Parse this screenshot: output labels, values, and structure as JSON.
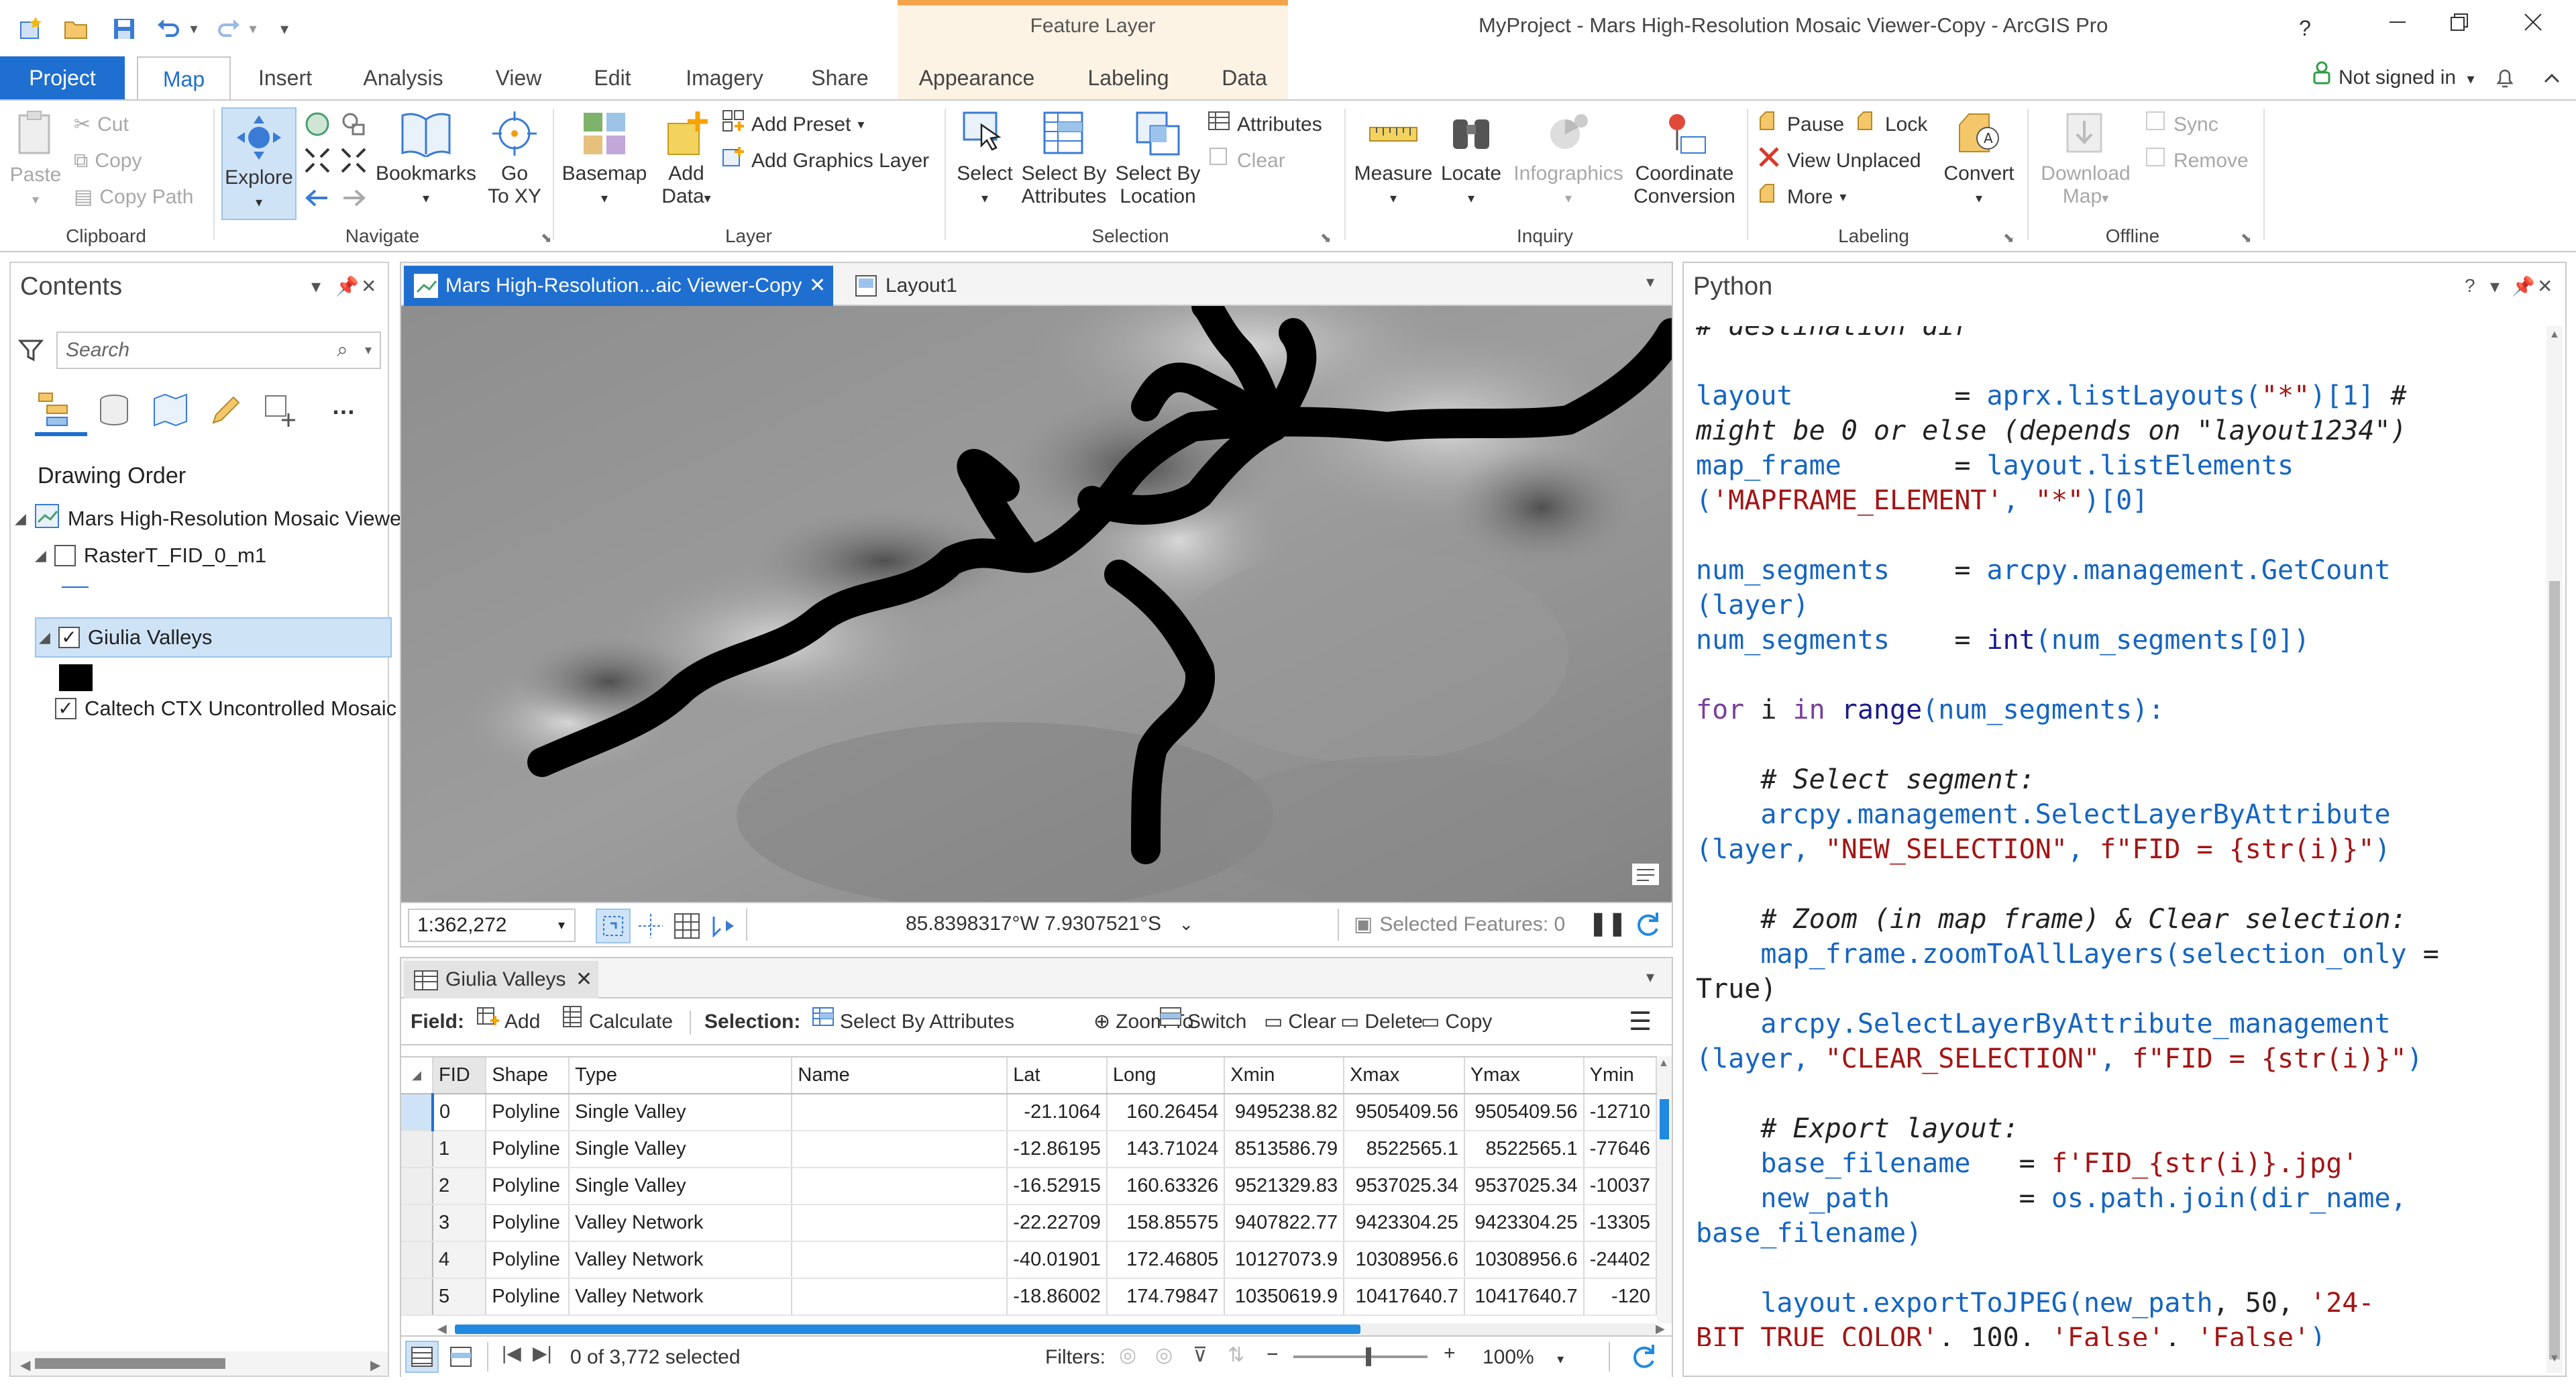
{
  "window": {
    "title": "MyProject - Mars High-Resolution Mosaic Viewer-Copy - ArcGIS Pro",
    "context_group": "Feature Layer",
    "help": "?",
    "signin": "Not signed in",
    "signin_arrow": "▾"
  },
  "ribbon_tabs": [
    "Project",
    "Map",
    "Insert",
    "Analysis",
    "View",
    "Edit",
    "Imagery",
    "Share",
    "Appearance",
    "Labeling",
    "Data"
  ],
  "ribbon": {
    "clipboard": {
      "label": "Clipboard",
      "paste": "Paste",
      "cut": "Cut",
      "copy": "Copy",
      "copy_path": "Copy Path"
    },
    "navigate": {
      "label": "Navigate",
      "explore": "Explore",
      "bookmarks": "Bookmarks",
      "goto": "Go",
      "goto2": "To XY"
    },
    "layer": {
      "label": "Layer",
      "basemap": "Basemap",
      "add_data": "Add",
      "add_data2": "Data",
      "add_preset": "Add Preset",
      "add_graphics": "Add Graphics Layer"
    },
    "selection": {
      "label": "Selection",
      "select": "Select",
      "by_attr": "Select By",
      "by_attr2": "Attributes",
      "by_loc": "Select By",
      "by_loc2": "Location",
      "attributes": "Attributes",
      "clear": "Clear"
    },
    "inquiry": {
      "label": "Inquiry",
      "measure": "Measure",
      "locate": "Locate",
      "infographics": "Infographics",
      "coord": "Coordinate",
      "coord2": "Conversion"
    },
    "labeling": {
      "label": "Labeling",
      "pause": "Pause",
      "lock": "Lock",
      "view_unplaced": "View Unplaced",
      "more": "More",
      "convert": "Convert"
    },
    "offline": {
      "label": "Offline",
      "download": "Download",
      "download2": "Map",
      "sync": "Sync",
      "remove": "Remove"
    }
  },
  "contents": {
    "title": "Contents",
    "search_placeholder": "Search",
    "drawing_order": "Drawing Order",
    "map_name": "Mars High-Resolution Mosaic Viewe",
    "layers": [
      {
        "name": "RasterT_FID_0_m1",
        "checked": false
      },
      {
        "name": "Giulia Valleys",
        "checked": true
      },
      {
        "name": "Caltech CTX Uncontrolled Mosaic",
        "checked": true
      }
    ]
  },
  "map": {
    "tab1": "Mars High-Resolution...aic Viewer-Copy",
    "tab2": "Layout1",
    "scale": "1:362,272",
    "coords": "85.8398317°W 7.9307521°S",
    "selected_features": "Selected Features: 0"
  },
  "attribute_table": {
    "tab": "Giulia Valleys",
    "field_label": "Field:",
    "add": "Add",
    "calculate": "Calculate",
    "selection_label": "Selection:",
    "select_by_attr": "Select By Attributes",
    "zoom_to": "Zoom To",
    "switch": "Switch",
    "clear": "Clear",
    "delete": "Delete",
    "copy": "Copy",
    "columns": [
      "FID",
      "Shape",
      "Type",
      "Name",
      "Lat",
      "Long",
      "Xmin",
      "Xmax",
      "Ymax",
      "Ymin"
    ],
    "rows": [
      [
        "0",
        "Polyline",
        "Single Valley",
        "",
        "-21.1064",
        "160.26454",
        "9495238.82",
        "9505409.56",
        "9505409.56",
        "-12710"
      ],
      [
        "1",
        "Polyline",
        "Single Valley",
        "",
        "-12.86195",
        "143.71024",
        "8513586.79",
        "8522565.1",
        "8522565.1",
        "-77646"
      ],
      [
        "2",
        "Polyline",
        "Single Valley",
        "",
        "-16.52915",
        "160.63326",
        "9521329.83",
        "9537025.34",
        "9537025.34",
        "-10037"
      ],
      [
        "3",
        "Polyline",
        "Valley Network",
        "",
        "-22.22709",
        "158.85575",
        "9407822.77",
        "9423304.25",
        "9423304.25",
        "-13305"
      ],
      [
        "4",
        "Polyline",
        "Valley Network",
        "",
        "-40.01901",
        "172.46805",
        "10127073.9",
        "10308956.6",
        "10308956.6",
        "-24402"
      ],
      [
        "5",
        "Polyline",
        "Valley Network",
        "",
        "-18.86002",
        "174.79847",
        "10350619.9",
        "10417640.7",
        "10417640.7",
        "-120"
      ]
    ],
    "status": "0 of 3,772 selected",
    "filters": "Filters:",
    "zoom": "100%"
  },
  "python": {
    "title": "Python",
    "lines": [
      [
        [
          "c",
          "# destination dir"
        ]
      ],
      [
        [
          "t",
          ""
        ]
      ],
      [
        [
          "v",
          "layout"
        ],
        [
          "t",
          "          = "
        ],
        [
          "v",
          "aprx.listLayouts("
        ],
        [
          "s",
          "\"*\""
        ],
        [
          "v",
          ")[1]"
        ],
        [
          "c",
          " #"
        ]
      ],
      [
        [
          "c",
          "might be 0 or else (depends on \"layout1234\")"
        ]
      ],
      [
        [
          "v",
          "map_frame"
        ],
        [
          "t",
          "       = "
        ],
        [
          "v",
          "layout.listElements"
        ]
      ],
      [
        [
          "v",
          "("
        ],
        [
          "s",
          "'MAPFRAME_ELEMENT'"
        ],
        [
          "v",
          ", "
        ],
        [
          "s",
          "\"*\""
        ],
        [
          "v",
          ")[0]"
        ]
      ],
      [
        [
          "t",
          ""
        ]
      ],
      [
        [
          "v",
          "num_segments"
        ],
        [
          "t",
          "    = "
        ],
        [
          "v",
          "arcpy.management.GetCount"
        ]
      ],
      [
        [
          "v",
          "(layer)"
        ]
      ],
      [
        [
          "v",
          "num_segments"
        ],
        [
          "t",
          "    = "
        ],
        [
          "b",
          "int"
        ],
        [
          "v",
          "(num_segments[0])"
        ]
      ],
      [
        [
          "t",
          ""
        ]
      ],
      [
        [
          "k",
          "for"
        ],
        [
          "t",
          " i "
        ],
        [
          "k",
          "in"
        ],
        [
          "t",
          " "
        ],
        [
          "b",
          "range"
        ],
        [
          "v",
          "(num_segments):"
        ]
      ],
      [
        [
          "t",
          ""
        ]
      ],
      [
        [
          "t",
          "    "
        ],
        [
          "c",
          "# Select segment:"
        ]
      ],
      [
        [
          "t",
          "    "
        ],
        [
          "v",
          "arcpy.management.SelectLayerByAttribute"
        ]
      ],
      [
        [
          "v",
          "(layer, "
        ],
        [
          "s",
          "\"NEW_SELECTION\""
        ],
        [
          "v",
          ", "
        ],
        [
          "s",
          "f\"FID = {str(i)}\""
        ],
        [
          "v",
          ")"
        ]
      ],
      [
        [
          "t",
          ""
        ]
      ],
      [
        [
          "t",
          "    "
        ],
        [
          "c",
          "# Zoom (in map frame) & Clear selection:"
        ]
      ],
      [
        [
          "t",
          "    "
        ],
        [
          "v",
          "map_frame.zoomToAllLayers(selection_only"
        ],
        [
          "t",
          " ="
        ]
      ],
      [
        [
          "t",
          "True)"
        ]
      ],
      [
        [
          "t",
          "    "
        ],
        [
          "v",
          "arcpy.SelectLayerByAttribute_management"
        ]
      ],
      [
        [
          "v",
          "(layer, "
        ],
        [
          "s",
          "\"CLEAR_SELECTION\""
        ],
        [
          "v",
          ", "
        ],
        [
          "s",
          "f\"FID = {str(i)}\""
        ],
        [
          "v",
          ")"
        ]
      ],
      [
        [
          "t",
          ""
        ]
      ],
      [
        [
          "t",
          "    "
        ],
        [
          "c",
          "# Export layout:"
        ]
      ],
      [
        [
          "t",
          "    "
        ],
        [
          "v",
          "base_filename"
        ],
        [
          "t",
          "   = "
        ],
        [
          "s",
          "f'FID_{str(i)}.jpg'"
        ]
      ],
      [
        [
          "t",
          "    "
        ],
        [
          "v",
          "new_path"
        ],
        [
          "t",
          "        = "
        ],
        [
          "v",
          "os.path.join(dir_name,"
        ]
      ],
      [
        [
          "v",
          "base_filename)"
        ]
      ],
      [
        [
          "t",
          ""
        ]
      ],
      [
        [
          "t",
          "    "
        ],
        [
          "v",
          "layout.exportToJPEG(new_path"
        ],
        [
          "t",
          ", 50, "
        ],
        [
          "s",
          "'24-"
        ]
      ],
      [
        [
          "s",
          "BIT_TRUE_COLOR'"
        ],
        [
          "t",
          ", 100, "
        ],
        [
          "s",
          "'False'"
        ],
        [
          "t",
          ", "
        ],
        [
          "s",
          "'False'"
        ],
        [
          "v",
          ")"
        ]
      ]
    ]
  }
}
